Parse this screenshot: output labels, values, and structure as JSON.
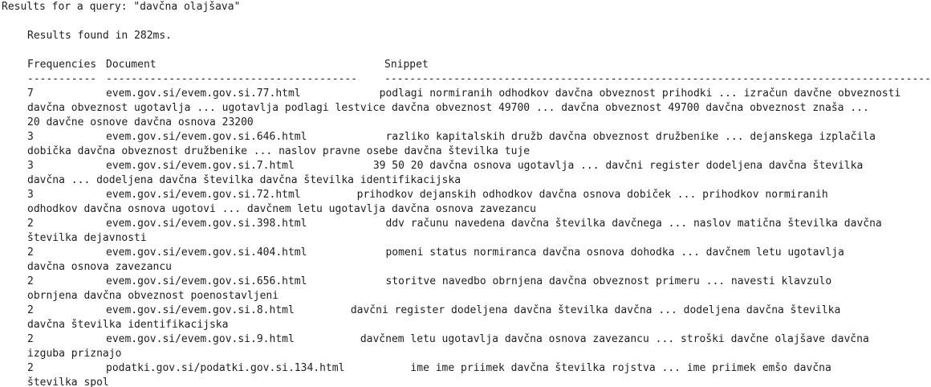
{
  "query_line": "Results for a query: \"davčna olajšava\"",
  "results_found": "Results found in 282ms.",
  "headers": {
    "freq": "Frequencies",
    "doc": "Document",
    "snippet": "Snippet"
  },
  "separators": {
    "freq": "-----------",
    "doc": "----------------------------------------",
    "snippet": "---------------------------------------------------------------------------------------------"
  },
  "results": [
    {
      "freq": "7",
      "doc": "evem.gov.si/evem.gov.si.77.html",
      "snippet_first": "podlagi normiranih odhodkov davčna obveznost prihodki ... izračun davčne obveznosti",
      "snippet_rest": [
        "davčna obveznost ugotavlja ... ugotavlja podlagi lestvice davčna obveznost 49700 ... davčna obveznost 49700 davčna obveznost znaša ...",
        "20 davčne osnove davčna osnova 23200"
      ]
    },
    {
      "freq": "3",
      "doc": "evem.gov.si/evem.gov.si.646.html",
      "snippet_first": "razliko kapitalskih družb davčna obveznost družbenike ... dejanskega izplačila",
      "snippet_rest": [
        "dobička davčna obveznost družbenike ... naslov pravne osebe davčna številka tuje"
      ]
    },
    {
      "freq": "3",
      "doc": "evem.gov.si/evem.gov.si.7.html",
      "snippet_first": "39 50 20 davčna osnova ugotavlja ... davčni register dodeljena davčna številka",
      "snippet_rest": [
        "davčna ... dodeljena davčna številka davčna številka identifikacijska"
      ]
    },
    {
      "freq": "3",
      "doc": "evem.gov.si/evem.gov.si.72.html",
      "snippet_first": "prihodkov dejanskih odhodkov davčna osnova dobiček ... prihodkov normiranih",
      "snippet_rest": [
        "odhodkov davčna osnova ugotovi ... davčnem letu ugotavlja davčna osnova zavezancu"
      ]
    },
    {
      "freq": "2",
      "doc": "evem.gov.si/evem.gov.si.398.html",
      "snippet_first": "ddv računu navedena davčna številka davčnega ... naslov matična številka davčna",
      "snippet_rest": [
        "številka dejavnosti"
      ]
    },
    {
      "freq": "2",
      "doc": "evem.gov.si/evem.gov.si.404.html",
      "snippet_first": "pomeni status normiranca davčna osnova dohodka ... davčnem letu ugotavlja",
      "snippet_rest": [
        "davčna osnova zavezancu"
      ]
    },
    {
      "freq": "2",
      "doc": "evem.gov.si/evem.gov.si.656.html",
      "snippet_first": "storitve navedbo obrnjena davčna obveznost primeru ... navesti klavzulo",
      "snippet_rest": [
        "obrnjena davčna obveznost poenostavljeni"
      ]
    },
    {
      "freq": "2",
      "doc": "evem.gov.si/evem.gov.si.8.html",
      "snippet_first": "davčni register dodeljena davčna številka davčna ... dodeljena davčna številka",
      "snippet_rest": [
        "davčna številka identifikacijska"
      ]
    },
    {
      "freq": "2",
      "doc": "evem.gov.si/evem.gov.si.9.html",
      "snippet_first": "davčnem letu ugotavlja davčna osnova zavezancu ... stroški davčne olajšave davčna",
      "snippet_rest": [
        "izguba priznajo"
      ]
    },
    {
      "freq": "2",
      "doc": "podatki.gov.si/podatki.gov.si.134.html",
      "snippet_first": "ime ime priimek davčna številka rojstva ... ime priimek emšo davčna",
      "snippet_rest": [
        "številka spol"
      ]
    }
  ]
}
